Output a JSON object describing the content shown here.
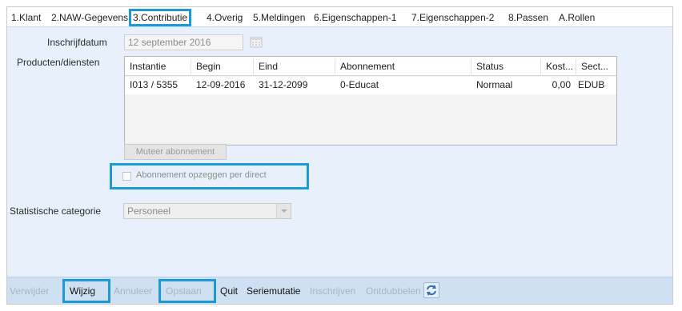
{
  "tabs": [
    {
      "label": "1.Klant"
    },
    {
      "label": "2.NAW-Gegevens"
    },
    {
      "label": "3.Contributie"
    },
    {
      "label": "4.Overig"
    },
    {
      "label": "5.Meldingen"
    },
    {
      "label": "6.Eigenschappen-1"
    },
    {
      "label": "7.Eigenschappen-2"
    },
    {
      "label": "8.Passen"
    },
    {
      "label": "A.Rollen"
    }
  ],
  "active_tab": "3.Contributie",
  "form": {
    "inschrijfdatum_label": "Inschrijfdatum",
    "inschrijfdatum_value": "12 september 2016",
    "producten_label": "Producten/diensten",
    "statistische_label": "Statistische categorie",
    "statistische_value": "Personeel",
    "muteer_button": "Muteer abonnement",
    "opzeggen_label": "Abonnement opzeggen per direct",
    "opzeggen_checked": false
  },
  "grid": {
    "columns": [
      "Instantie",
      "Begin",
      "Eind",
      "Abonnement",
      "Status",
      "Kost...",
      "Sect..."
    ],
    "rows": [
      [
        "I013 / 5355",
        "12-09-2016",
        "31-12-2099",
        "0-Educat",
        "Normaal",
        "0,00",
        "EDUB"
      ]
    ]
  },
  "toolbar": {
    "verwijder": "Verwijder",
    "wijzig": "Wijzig",
    "annuleer": "Annuleer",
    "opslaan": "Opslaan",
    "quit": "Quit",
    "seriemutatie": "Seriemutatie",
    "inschrijven": "Inschrijven",
    "ontdubbelen": "Ontdubbelen",
    "refresh_icon": "refresh-icon"
  },
  "colors": {
    "highlight": "#1a9ad6",
    "panel_bg": "#e8f1fb",
    "toolbar_bg": "#cfe0f3"
  }
}
